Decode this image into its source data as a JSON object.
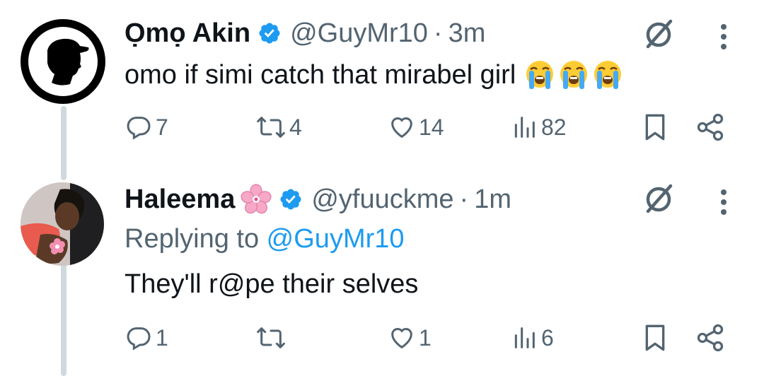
{
  "tweets": [
    {
      "display_name": "Ọmọ Akin",
      "handle": "@GuyMr10",
      "separator": "·",
      "time": "3m",
      "text": "omo if simi catch that mirabel girl",
      "emojis": [
        "loudly-crying-face",
        "loudly-crying-face",
        "loudly-crying-face"
      ],
      "counts": {
        "replies": "7",
        "retweets": "4",
        "likes": "14",
        "views": "82"
      }
    },
    {
      "display_name": "Haleema",
      "handle": "@yfuuckme",
      "separator": "·",
      "time": "1m",
      "replying_prefix": "Replying to ",
      "replying_handle": "@GuyMr10",
      "text": "They'll r@pe their selves",
      "counts": {
        "replies": "1",
        "retweets": "",
        "likes": "1",
        "views": "6"
      }
    }
  ],
  "icons": [
    "verified-badge-icon",
    "grok-icon",
    "more-icon",
    "reply-icon",
    "retweet-icon",
    "like-icon",
    "views-icon",
    "bookmark-icon",
    "share-icon",
    "cherry-blossom-icon"
  ],
  "colors": {
    "text": "#0f1419",
    "secondary": "#536471",
    "accent": "#1d9bf0",
    "thread_line": "#cfd9de"
  }
}
